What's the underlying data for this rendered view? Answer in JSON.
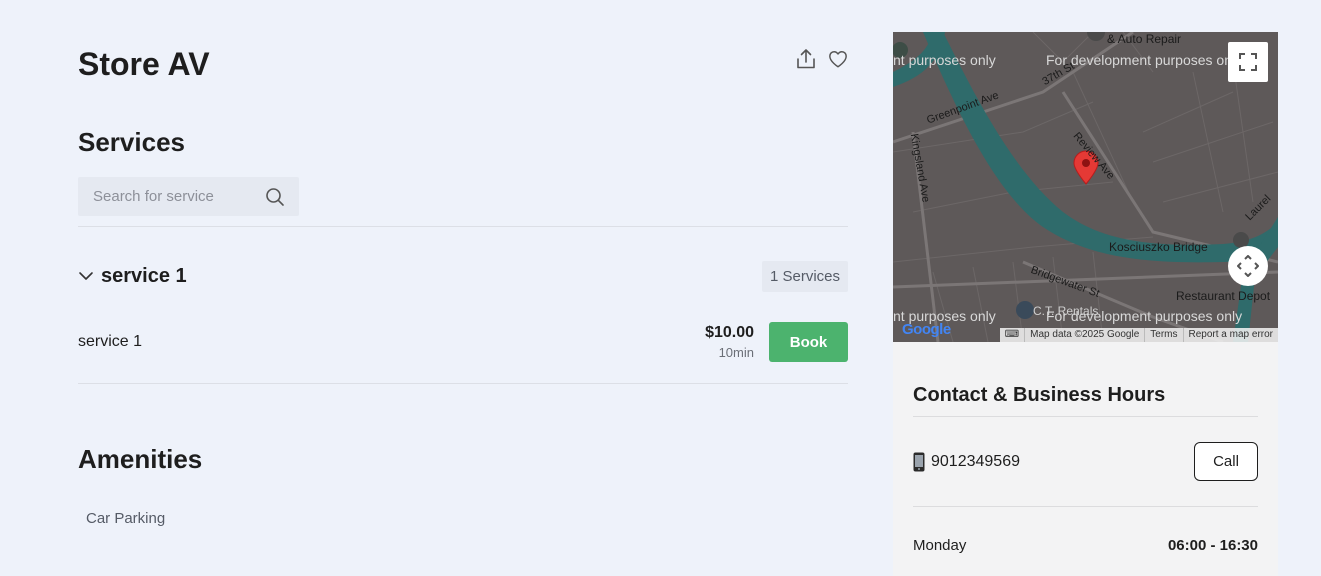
{
  "store": {
    "title": "Store AV"
  },
  "actions": {
    "share_icon": "share-icon",
    "favorite_icon": "heart-icon"
  },
  "services": {
    "title": "Services",
    "search_placeholder": "Search for service",
    "categories": [
      {
        "name": "service 1",
        "count_label": "1 Services",
        "items": [
          {
            "name": "service 1",
            "price": "$10.00",
            "duration": "10min",
            "book_label": "Book"
          }
        ]
      }
    ]
  },
  "amenities": {
    "title": "Amenities",
    "items": [
      "Car Parking"
    ]
  },
  "map": {
    "streets": [
      "Greenpoint Ave",
      "Kingsland Ave",
      "37th St",
      "Review Ave",
      "Kosciuszko Bridge",
      "Bridgewater St",
      "Laurel",
      "& Auto Repair",
      "Restaurant Depot",
      "C.T. Rentals"
    ],
    "dev_text": "For development purposes only",
    "dev_text_left": "nt purposes only",
    "logo": "Google",
    "attribution": [
      "Map data ©2025 Google",
      "Terms",
      "Report a map error"
    ]
  },
  "contact": {
    "title": "Contact & Business Hours",
    "phone": "9012349569",
    "call_label": "Call",
    "hours": [
      {
        "day": "Monday",
        "time": "06:00 - 16:30"
      }
    ]
  },
  "colors": {
    "book_green": "#4cb36e",
    "background": "#eef2fa",
    "panel": "#f3f3f4"
  }
}
